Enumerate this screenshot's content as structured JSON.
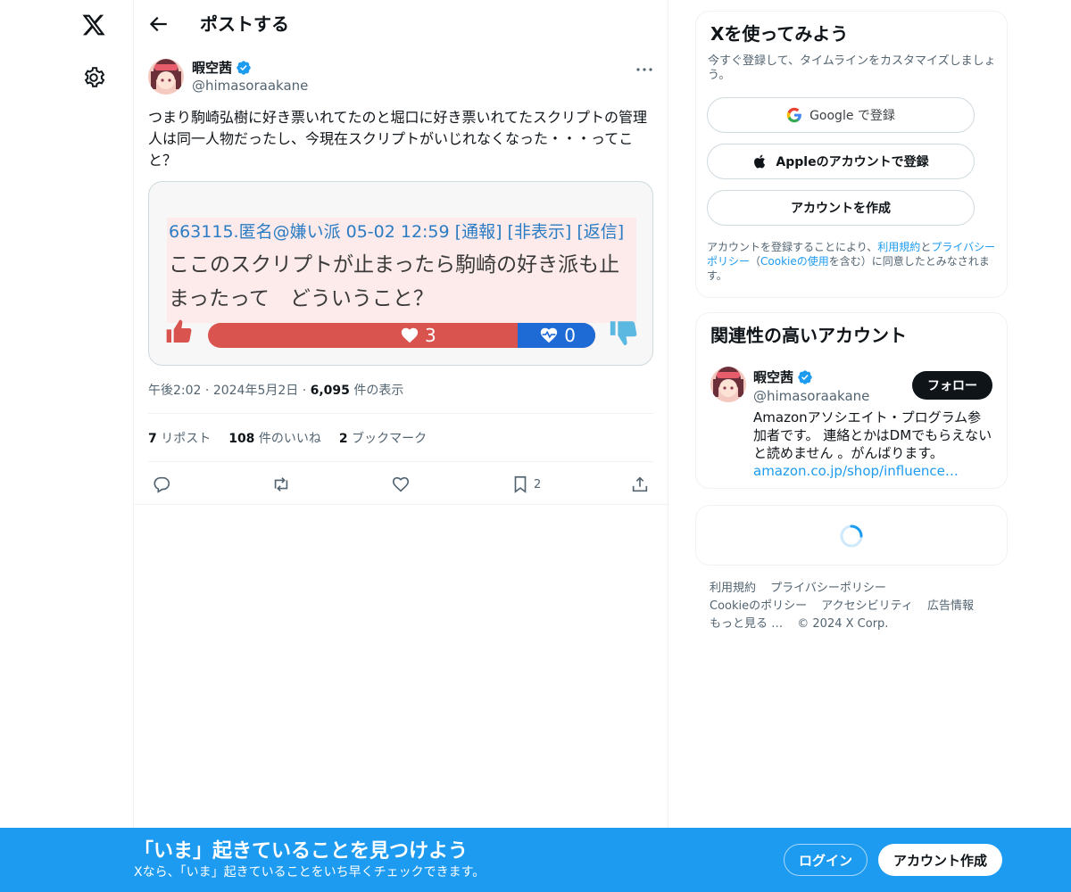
{
  "nav": {
    "logo_icon": "x-logo-icon",
    "settings_icon": "gear-icon"
  },
  "header": {
    "title": "ポストする",
    "back_icon": "arrow-left-icon"
  },
  "post": {
    "author_name": "暇空茜",
    "author_handle": "@himasoraakane",
    "text": "つまり駒崎弘樹に好き票いれてたのと堀口に好き票いれてたスクリプトの管理人は同一人物だったし、今現在スクリプトがいじれなくなった・・・ってこと？",
    "media": {
      "header": "663115.匿名@嫌い派 05-02 12:59 [通報] [非表示] [返信]",
      "body": "ここのスクリプトが止まったら駒崎の好き派も止まったって　どういうこと？",
      "like_count": "3",
      "dislike_count": "0",
      "like_ratio": 0.8
    },
    "meta": {
      "time": "午後2:02",
      "date": "2024年5月2日",
      "views": "6,095",
      "views_label": "件の表示"
    },
    "stats": {
      "reposts": "7",
      "reposts_label": "リポスト",
      "likes": "108",
      "likes_label": "件のいいね",
      "bookmarks": "2",
      "bookmarks_label": "ブックマーク"
    },
    "actions": {
      "bookmark_count": "2"
    }
  },
  "signup_card": {
    "title": "Xを使ってみよう",
    "subtitle": "今すぐ登録して、タイムラインをカスタマイズしましょう。",
    "google_label": "Google で登録",
    "apple_label": "Appleのアカウントで登録",
    "create_label": "アカウントを作成",
    "terms_prefix": "アカウントを登録することにより、",
    "terms_link": "利用規約",
    "terms_and": "と",
    "privacy_link": "プライバシーポリシー",
    "terms_paren_open": "（",
    "cookie_link": "Cookieの使用",
    "terms_suffix": "を含む）に同意したとみなされます。"
  },
  "related_card": {
    "title": "関連性の高いアカウント",
    "name": "暇空茜",
    "handle": "@himasoraakane",
    "follow_label": "フォロー",
    "bio": "Amazonアソシエイト・プログラム参加者です。 連絡とかはDMでもらえないと読めません 。がんばります。",
    "bio_link": "amazon.co.jp/shop/influence…"
  },
  "footer": {
    "terms": "利用規約",
    "privacy": "プライバシーポリシー",
    "cookie": "Cookieのポリシー",
    "accessibility": "アクセシビリティ",
    "ads": "広告情報",
    "more": "もっと見る …",
    "copyright": "© 2024 X Corp."
  },
  "bottom_bar": {
    "title": "「いま」起きていることを見つけよう",
    "subtitle": "Xなら、「いま」起きていることをいち早くチェックできます。",
    "login_label": "ログイン",
    "signup_label": "アカウント作成"
  },
  "colors": {
    "accent": "#1d9bf0",
    "text": "#0f1419",
    "muted": "#536471"
  }
}
